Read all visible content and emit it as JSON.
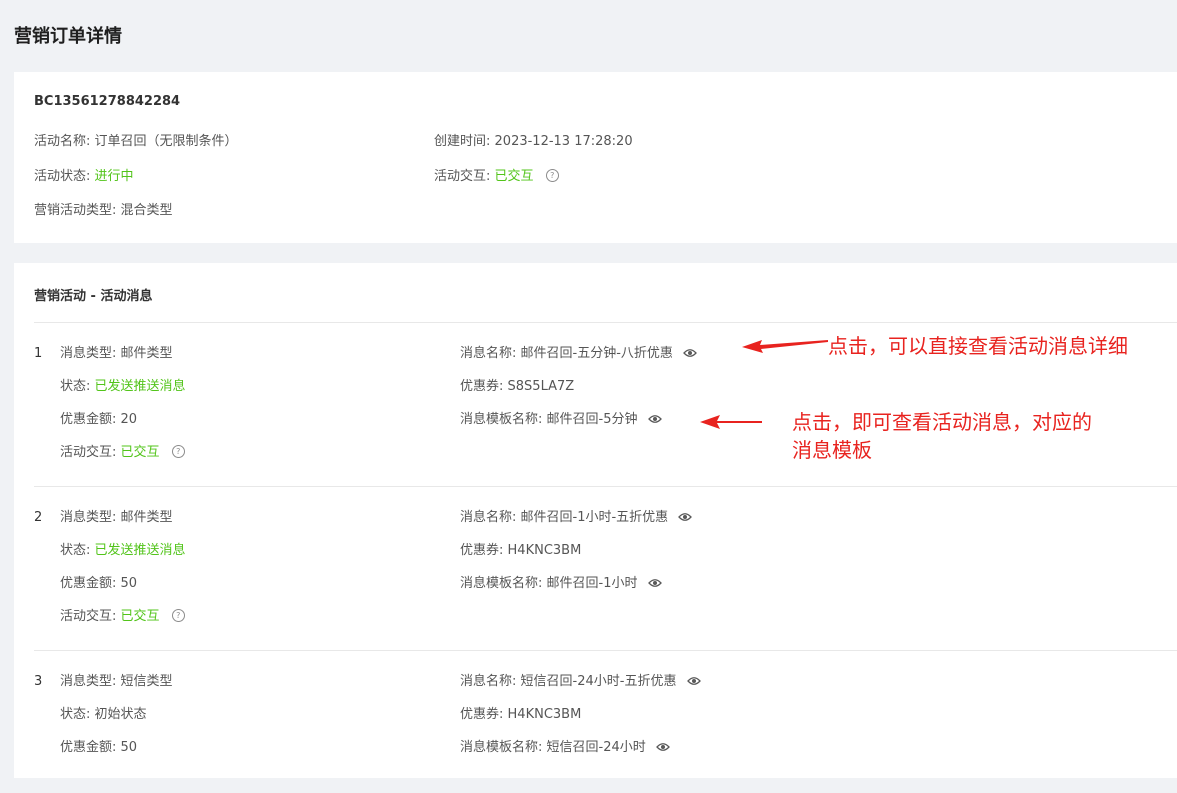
{
  "page_title": "营销订单详情",
  "order": {
    "id": "BC13561278842284",
    "activity_name_label": "活动名称:",
    "activity_name": "订单召回（无限制条件）",
    "created_label": "创建时间:",
    "created": "2023-12-13 17:28:20",
    "status_label": "活动状态:",
    "status": "进行中",
    "interaction_label": "活动交互:",
    "interaction": "已交互",
    "type_label": "营销活动类型:",
    "type": "混合类型"
  },
  "messages_section": {
    "title": "营销活动 - 活动消息",
    "labels": {
      "msg_type": "消息类型:",
      "status": "状态:",
      "discount": "优惠金额:",
      "interaction": "活动交互:",
      "msg_name": "消息名称:",
      "coupon": "优惠券:",
      "template": "消息模板名称:"
    },
    "items": [
      {
        "index": "1",
        "msg_type": "邮件类型",
        "status": "已发送推送消息",
        "discount": "20",
        "interaction": "已交互",
        "msg_name": "邮件召回-五分钟-八折优惠",
        "coupon": "S8S5LA7Z",
        "template": "邮件召回-5分钟"
      },
      {
        "index": "2",
        "msg_type": "邮件类型",
        "status": "已发送推送消息",
        "discount": "50",
        "interaction": "已交互",
        "msg_name": "邮件召回-1小时-五折优惠",
        "coupon": "H4KNC3BM",
        "template": "邮件召回-1小时"
      },
      {
        "index": "3",
        "msg_type": "短信类型",
        "status": "初始状态",
        "discount": "50",
        "msg_name": "短信召回-24小时-五折优惠",
        "coupon": "H4KNC3BM",
        "template": "短信召回-24小时"
      }
    ]
  },
  "annotations": {
    "note_1": "点击，可以直接查看活动消息详细",
    "note_2_line1": "点击，即可查看活动消息，对应的",
    "note_2_line2": "消息模板"
  },
  "colors": {
    "success": "#52c41a",
    "annotation": "#e8231f",
    "background": "#f0f2f5"
  }
}
